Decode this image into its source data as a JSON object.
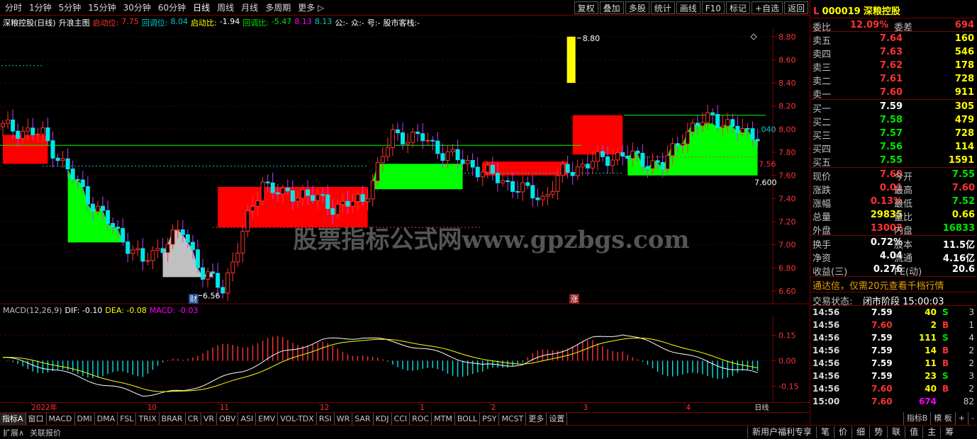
{
  "periods": [
    "分时",
    "1分钟",
    "5分钟",
    "15分钟",
    "30分钟",
    "60分钟",
    "日线",
    "周线",
    "月线",
    "多周期",
    "更多 ▷"
  ],
  "top_buttons": [
    "复权",
    "叠加",
    "多股",
    "统计",
    "画线",
    "F10",
    "标记",
    "+自选",
    "返回"
  ],
  "title_line": {
    "stock": "深粮控股(日线)",
    "indicator": "升浪主图",
    "qidongwei_label": "启动位:",
    "qidongwei": "7.75",
    "huitiaowei_label": "回调位:",
    "huitiaowei": "8.04",
    "qidongbi_label": "启动比:",
    "qidongbi": "-1.94",
    "huitiaobi_label": "回调比:",
    "huitiaobi": "-5.47",
    "v1": "8.13",
    "v2": "8.13",
    "gong": "公:-",
    "zhong": "众:-",
    "hao": "号:-",
    "guzhan": "股市客栈:-"
  },
  "watermark": "股票指标公式网www.gpzbgs.com",
  "price_axis": [
    "8.80",
    "8.60",
    "8.40",
    "8.20",
    "8.00",
    "7.80",
    "7.60",
    "7.40",
    "7.20",
    "7.00",
    "6.80",
    "6.60"
  ],
  "annotations": {
    "high": "8.80",
    "low": "6.56",
    "last": "7.600",
    "side_a": ".040",
    "side_b": "7.56",
    "cai": "财",
    "zhang": "涨"
  },
  "macd_line": {
    "name": "MACD(12,26,9)",
    "dif": "DIF: -0.10",
    "dea": "DEA: -0.08",
    "macd": "MACD: -0.03"
  },
  "macd_axis": [
    "0.15",
    "0.00",
    "-0.15"
  ],
  "x_axis": [
    "2022年",
    "10",
    "11",
    "12",
    "1",
    "2",
    "3",
    "4"
  ],
  "x_axis_right": "日线",
  "indicator_tabs": [
    "指标A",
    "窗口",
    "MACD",
    "DMI",
    "DMA",
    "FSL",
    "TRIX",
    "BRAR",
    "CR",
    "VR",
    "OBV",
    "ASI",
    "EMV",
    "VOL-TDX",
    "RSI",
    "WR",
    "SAR",
    "KDJ",
    "CCI",
    "ROC",
    "MTM",
    "BOLL",
    "PSY",
    "MCST",
    "更多",
    "设置"
  ],
  "indicator_right": [
    "指标B",
    "模 板",
    "+",
    "-"
  ],
  "bottom_left": [
    "扩展∧",
    "关联报价"
  ],
  "bottom_right": [
    "新用户福利专享",
    "笔",
    "价",
    "细",
    "势",
    "联",
    "值",
    "主",
    "筹"
  ],
  "quote": {
    "code": "000019",
    "name": "深粮控股",
    "weibi_label": "委比",
    "weibi": "12.09%",
    "weicha_label": "委差",
    "weicha": "694",
    "asks": [
      {
        "label": "卖五",
        "price": "7.64",
        "vol": "160"
      },
      {
        "label": "卖四",
        "price": "7.63",
        "vol": "546"
      },
      {
        "label": "卖三",
        "price": "7.62",
        "vol": "178"
      },
      {
        "label": "卖二",
        "price": "7.61",
        "vol": "728"
      },
      {
        "label": "卖一",
        "price": "7.60",
        "vol": "911"
      }
    ],
    "bids": [
      {
        "label": "买一",
        "price": "7.59",
        "vol": "305"
      },
      {
        "label": "买二",
        "price": "7.58",
        "vol": "479"
      },
      {
        "label": "买三",
        "price": "7.57",
        "vol": "728"
      },
      {
        "label": "买四",
        "price": "7.56",
        "vol": "114"
      },
      {
        "label": "买五",
        "price": "7.55",
        "vol": "1591"
      }
    ],
    "stats": [
      {
        "l1": "现价",
        "v1": "7.60",
        "l2": "今开",
        "v2": "7.55"
      },
      {
        "l1": "涨跌",
        "v1": "0.01",
        "l2": "最高",
        "v2": "7.60"
      },
      {
        "l1": "涨幅",
        "v1": "0.13%",
        "l2": "最低",
        "v2": "7.52"
      },
      {
        "l1": "总量",
        "v1": "29835",
        "l2": "量比",
        "v2": "0.66"
      },
      {
        "l1": "外盘",
        "v1": "13002",
        "l2": "内盘",
        "v2": "16833"
      }
    ],
    "fin": [
      {
        "l1": "换手",
        "v1": "0.72%",
        "l2": "股本",
        "v2": "11.5亿"
      },
      {
        "l1": "净资",
        "v1": "4.04",
        "l2": "流通",
        "v2": "4.16亿"
      },
      {
        "l1": "收益(三)",
        "v1": "0.276",
        "l2": "PE(动)",
        "v2": "20.6"
      }
    ],
    "ad": "通达信，仅需20元查看千档行情",
    "trade_status_label": "交易状态:",
    "trade_status": "闭市阶段 15:00:03",
    "ticks": [
      {
        "t": "14:56",
        "p": "7.59",
        "v": "40",
        "d": "S",
        "n": "3"
      },
      {
        "t": "14:56",
        "p": "7.60",
        "v": "2",
        "d": "B",
        "n": "1"
      },
      {
        "t": "14:56",
        "p": "7.59",
        "v": "111",
        "d": "S",
        "n": "4"
      },
      {
        "t": "14:56",
        "p": "7.59",
        "v": "14",
        "d": "B",
        "n": "2"
      },
      {
        "t": "14:56",
        "p": "7.59",
        "v": "11",
        "d": "B",
        "n": "2"
      },
      {
        "t": "14:56",
        "p": "7.59",
        "v": "23",
        "d": "S",
        "n": "3"
      },
      {
        "t": "14:56",
        "p": "7.60",
        "v": "40",
        "d": "B",
        "n": "2"
      },
      {
        "t": "15:00",
        "p": "7.60",
        "v": "674",
        "d": "",
        "n": "82"
      }
    ]
  },
  "colors": {
    "up": "#ff3232",
    "down": "#00e6e6",
    "rise_fill": "#ff0000",
    "fall_fill": "#00ff00",
    "gray_fill": "#c0c0c0",
    "axis": "#7a0000"
  }
}
